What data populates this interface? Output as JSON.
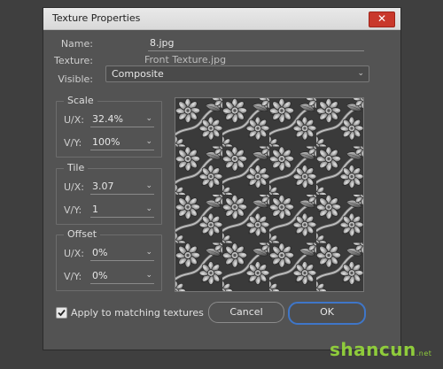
{
  "dialog": {
    "title": "Texture Properties",
    "close_icon": "close-icon"
  },
  "fields": {
    "name_label": "Name:",
    "name_value": "8.jpg",
    "texture_label": "Texture:",
    "texture_value": "Front Texture.jpg",
    "visible_label": "Visible:",
    "visible_value": "Composite"
  },
  "scale": {
    "title": "Scale",
    "ux_label": "U/X:",
    "ux_value": "32.4%",
    "vy_label": "V/Y:",
    "vy_value": "100%"
  },
  "tile": {
    "title": "Tile",
    "ux_label": "U/X:",
    "ux_value": "3.07",
    "vy_label": "V/Y:",
    "vy_value": "1"
  },
  "offset": {
    "title": "Offset",
    "ux_label": "U/X:",
    "ux_value": "0%",
    "vy_label": "V/Y:",
    "vy_value": "0%"
  },
  "apply_checkbox": {
    "label": "Apply to matching textures",
    "checked": true
  },
  "buttons": {
    "cancel": "Cancel",
    "ok": "OK"
  },
  "watermark": {
    "text": "shancun",
    "suffix": ".net"
  },
  "colors": {
    "dialog_bg": "#535353",
    "accent_ok": "#3f76c8",
    "close_red": "#c9382b"
  }
}
